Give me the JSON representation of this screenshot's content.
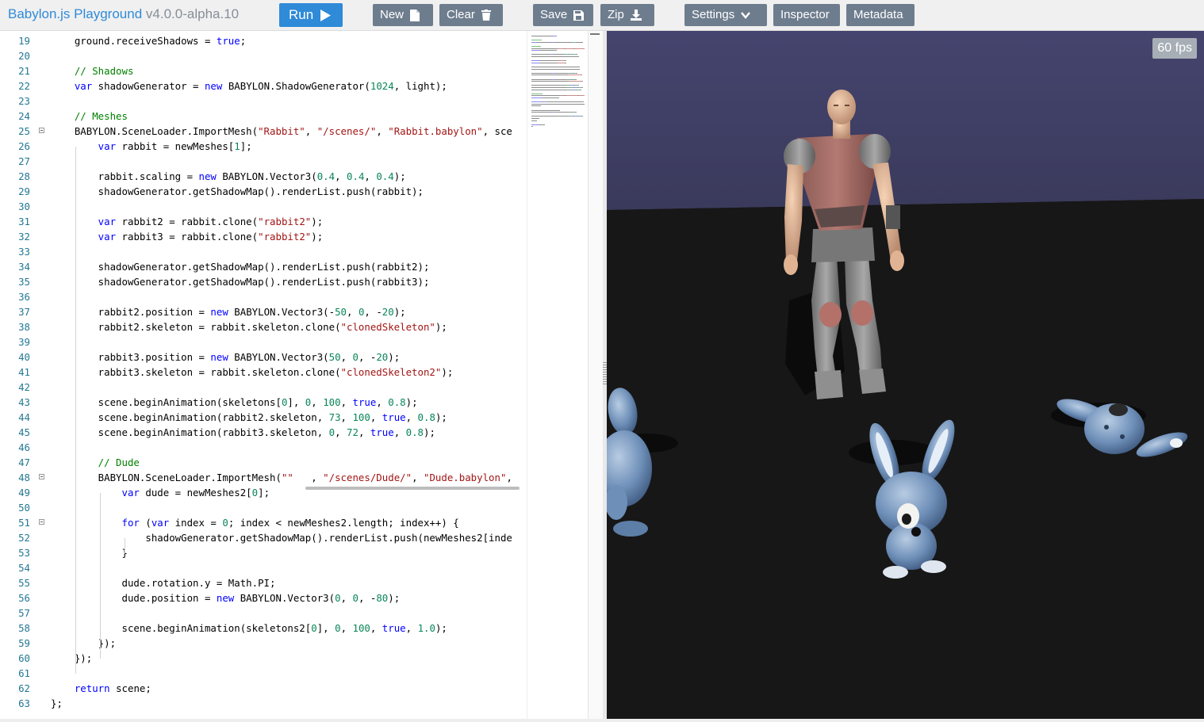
{
  "header": {
    "brand_name": "Babylon.js Playground",
    "brand_version": "v4.0.0-alpha.10",
    "buttons": {
      "run": "Run",
      "new": "New",
      "clear": "Clear",
      "save": "Save",
      "zip": "Zip",
      "settings": "Settings",
      "inspector": "Inspector",
      "metadata": "Metadata"
    }
  },
  "editor": {
    "lines": [
      {
        "n": "19",
        "tokens": [
          [
            "tx",
            "    ground.receiveShadows = "
          ],
          [
            "kw",
            "true"
          ],
          [
            "tx",
            ";"
          ]
        ]
      },
      {
        "n": "20",
        "tokens": []
      },
      {
        "n": "21",
        "tokens": [
          [
            "cm",
            "    // Shadows"
          ]
        ]
      },
      {
        "n": "22",
        "tokens": [
          [
            "kw",
            "    var"
          ],
          [
            "tx",
            " shadowGenerator = "
          ],
          [
            "kw",
            "new"
          ],
          [
            "tx",
            " BABYLON.ShadowGenerator("
          ],
          [
            "num",
            "1024"
          ],
          [
            "tx",
            ", light);"
          ]
        ]
      },
      {
        "n": "23",
        "tokens": []
      },
      {
        "n": "24",
        "tokens": [
          [
            "cm",
            "    // Meshes"
          ]
        ]
      },
      {
        "n": "25",
        "fold": true,
        "tokens": [
          [
            "tx",
            "    BABYLON.SceneLoader.ImportMesh("
          ],
          [
            "str",
            "\"Rabbit\""
          ],
          [
            "tx",
            ", "
          ],
          [
            "str",
            "\"/scenes/\""
          ],
          [
            "tx",
            ", "
          ],
          [
            "str",
            "\"Rabbit.babylon\""
          ],
          [
            "tx",
            ", sce"
          ]
        ]
      },
      {
        "n": "26",
        "tokens": [
          [
            "kw",
            "        var"
          ],
          [
            "tx",
            " rabbit = newMeshes["
          ],
          [
            "num",
            "1"
          ],
          [
            "tx",
            "];"
          ]
        ]
      },
      {
        "n": "27",
        "tokens": []
      },
      {
        "n": "28",
        "tokens": [
          [
            "tx",
            "        rabbit.scaling = "
          ],
          [
            "kw",
            "new"
          ],
          [
            "tx",
            " BABYLON.Vector3("
          ],
          [
            "num",
            "0.4"
          ],
          [
            "tx",
            ", "
          ],
          [
            "num",
            "0.4"
          ],
          [
            "tx",
            ", "
          ],
          [
            "num",
            "0.4"
          ],
          [
            "tx",
            ");"
          ]
        ]
      },
      {
        "n": "29",
        "tokens": [
          [
            "tx",
            "        shadowGenerator.getShadowMap().renderList.push(rabbit);"
          ]
        ]
      },
      {
        "n": "30",
        "tokens": []
      },
      {
        "n": "31",
        "tokens": [
          [
            "kw",
            "        var"
          ],
          [
            "tx",
            " rabbit2 = rabbit.clone("
          ],
          [
            "str",
            "\"rabbit2\""
          ],
          [
            "tx",
            ");"
          ]
        ]
      },
      {
        "n": "32",
        "tokens": [
          [
            "kw",
            "        var"
          ],
          [
            "tx",
            " rabbit3 = rabbit.clone("
          ],
          [
            "str",
            "\"rabbit2\""
          ],
          [
            "tx",
            ");"
          ]
        ]
      },
      {
        "n": "33",
        "tokens": []
      },
      {
        "n": "34",
        "tokens": [
          [
            "tx",
            "        shadowGenerator.getShadowMap().renderList.push(rabbit2);"
          ]
        ]
      },
      {
        "n": "35",
        "tokens": [
          [
            "tx",
            "        shadowGenerator.getShadowMap().renderList.push(rabbit3);"
          ]
        ]
      },
      {
        "n": "36",
        "tokens": []
      },
      {
        "n": "37",
        "tokens": [
          [
            "tx",
            "        rabbit2.position = "
          ],
          [
            "kw",
            "new"
          ],
          [
            "tx",
            " BABYLON.Vector3(-"
          ],
          [
            "num",
            "50"
          ],
          [
            "tx",
            ", "
          ],
          [
            "num",
            "0"
          ],
          [
            "tx",
            ", -"
          ],
          [
            "num",
            "20"
          ],
          [
            "tx",
            ");"
          ]
        ]
      },
      {
        "n": "38",
        "tokens": [
          [
            "tx",
            "        rabbit2.skeleton = rabbit.skeleton.clone("
          ],
          [
            "str",
            "\"clonedSkeleton\""
          ],
          [
            "tx",
            ");"
          ]
        ]
      },
      {
        "n": "39",
        "tokens": []
      },
      {
        "n": "40",
        "tokens": [
          [
            "tx",
            "        rabbit3.position = "
          ],
          [
            "kw",
            "new"
          ],
          [
            "tx",
            " BABYLON.Vector3("
          ],
          [
            "num",
            "50"
          ],
          [
            "tx",
            ", "
          ],
          [
            "num",
            "0"
          ],
          [
            "tx",
            ", -"
          ],
          [
            "num",
            "20"
          ],
          [
            "tx",
            ");"
          ]
        ]
      },
      {
        "n": "41",
        "tokens": [
          [
            "tx",
            "        rabbit3.skeleton = rabbit.skeleton.clone("
          ],
          [
            "str",
            "\"clonedSkeleton2\""
          ],
          [
            "tx",
            ");"
          ]
        ]
      },
      {
        "n": "42",
        "tokens": []
      },
      {
        "n": "43",
        "tokens": [
          [
            "tx",
            "        scene.beginAnimation(skeletons["
          ],
          [
            "num",
            "0"
          ],
          [
            "tx",
            "], "
          ],
          [
            "num",
            "0"
          ],
          [
            "tx",
            ", "
          ],
          [
            "num",
            "100"
          ],
          [
            "tx",
            ", "
          ],
          [
            "kw",
            "true"
          ],
          [
            "tx",
            ", "
          ],
          [
            "num",
            "0.8"
          ],
          [
            "tx",
            ");"
          ]
        ]
      },
      {
        "n": "44",
        "tokens": [
          [
            "tx",
            "        scene.beginAnimation(rabbit2.skeleton, "
          ],
          [
            "num",
            "73"
          ],
          [
            "tx",
            ", "
          ],
          [
            "num",
            "100"
          ],
          [
            "tx",
            ", "
          ],
          [
            "kw",
            "true"
          ],
          [
            "tx",
            ", "
          ],
          [
            "num",
            "0.8"
          ],
          [
            "tx",
            ");"
          ]
        ]
      },
      {
        "n": "45",
        "tokens": [
          [
            "tx",
            "        scene.beginAnimation(rabbit3.skeleton, "
          ],
          [
            "num",
            "0"
          ],
          [
            "tx",
            ", "
          ],
          [
            "num",
            "72"
          ],
          [
            "tx",
            ", "
          ],
          [
            "kw",
            "true"
          ],
          [
            "tx",
            ", "
          ],
          [
            "num",
            "0.8"
          ],
          [
            "tx",
            ");"
          ]
        ]
      },
      {
        "n": "46",
        "tokens": []
      },
      {
        "n": "47",
        "tokens": [
          [
            "cm",
            "        // Dude"
          ]
        ]
      },
      {
        "n": "48",
        "fold": true,
        "tokens": [
          [
            "tx",
            "        BABYLON.SceneLoader.ImportMesh("
          ],
          [
            "str",
            "\"\""
          ],
          [
            "tx",
            "   , "
          ],
          [
            "str",
            "\"/scenes/Dude/\""
          ],
          [
            "tx",
            ", "
          ],
          [
            "str",
            "\"Dude.babylon\""
          ],
          [
            "tx",
            ","
          ]
        ]
      },
      {
        "n": "49",
        "tokens": [
          [
            "kw",
            "            var"
          ],
          [
            "tx",
            " dude = newMeshes2["
          ],
          [
            "num",
            "0"
          ],
          [
            "tx",
            "];"
          ]
        ]
      },
      {
        "n": "50",
        "tokens": []
      },
      {
        "n": "51",
        "fold": true,
        "tokens": [
          [
            "kw",
            "            for"
          ],
          [
            "tx",
            " ("
          ],
          [
            "kw",
            "var"
          ],
          [
            "tx",
            " index = "
          ],
          [
            "num",
            "0"
          ],
          [
            "tx",
            "; index < newMeshes2.length; index++) {"
          ]
        ]
      },
      {
        "n": "52",
        "tokens": [
          [
            "tx",
            "                shadowGenerator.getShadowMap().renderList.push(newMeshes2[inde"
          ]
        ]
      },
      {
        "n": "53",
        "tokens": [
          [
            "tx",
            "            }"
          ]
        ]
      },
      {
        "n": "54",
        "tokens": []
      },
      {
        "n": "55",
        "tokens": [
          [
            "tx",
            "            dude.rotation.y = Math.PI;"
          ]
        ]
      },
      {
        "n": "56",
        "tokens": [
          [
            "tx",
            "            dude.position = "
          ],
          [
            "kw",
            "new"
          ],
          [
            "tx",
            " BABYLON.Vector3("
          ],
          [
            "num",
            "0"
          ],
          [
            "tx",
            ", "
          ],
          [
            "num",
            "0"
          ],
          [
            "tx",
            ", -"
          ],
          [
            "num",
            "80"
          ],
          [
            "tx",
            ");"
          ]
        ]
      },
      {
        "n": "57",
        "tokens": []
      },
      {
        "n": "58",
        "tokens": [
          [
            "tx",
            "            scene.beginAnimation(skeletons2["
          ],
          [
            "num",
            "0"
          ],
          [
            "tx",
            "], "
          ],
          [
            "num",
            "0"
          ],
          [
            "tx",
            ", "
          ],
          [
            "num",
            "100"
          ],
          [
            "tx",
            ", "
          ],
          [
            "kw",
            "true"
          ],
          [
            "tx",
            ", "
          ],
          [
            "num",
            "1.0"
          ],
          [
            "tx",
            ");"
          ]
        ]
      },
      {
        "n": "59",
        "tokens": [
          [
            "tx",
            "        });"
          ]
        ]
      },
      {
        "n": "60",
        "tokens": [
          [
            "tx",
            "    });"
          ]
        ]
      },
      {
        "n": "61",
        "tokens": []
      },
      {
        "n": "62",
        "tokens": [
          [
            "kw",
            "    return"
          ],
          [
            "tx",
            " scene;"
          ]
        ]
      },
      {
        "n": "63",
        "tokens": [
          [
            "tx",
            "};"
          ]
        ]
      }
    ]
  },
  "canvas": {
    "fps_label": "60 fps"
  },
  "colors": {
    "accent": "#2f8ad8",
    "button": "#6e7d8e",
    "keyword": "#0000ff",
    "string": "#a31515",
    "number": "#098658",
    "comment": "#008000",
    "line_number": "#237893"
  }
}
